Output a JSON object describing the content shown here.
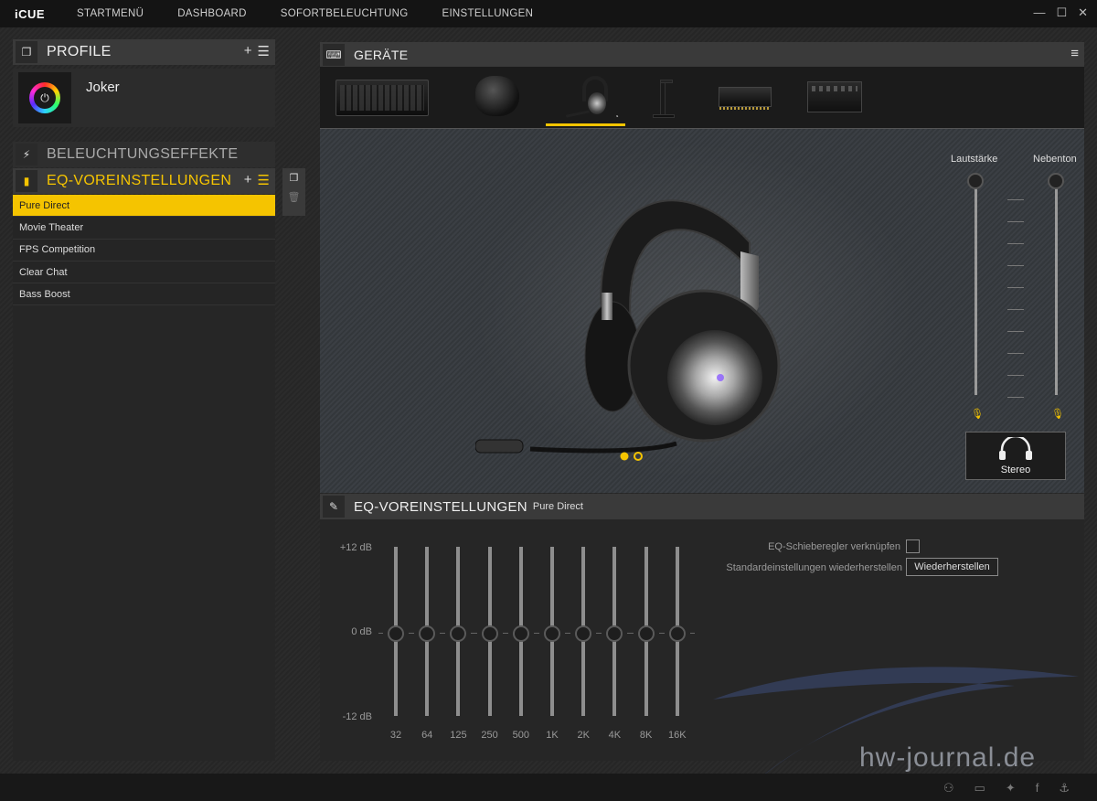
{
  "app": {
    "logo": "iCUE",
    "nav": [
      "STARTMENÜ",
      "DASHBOARD",
      "SOFORTBELEUCHTUNG",
      "EINSTELLUNGEN"
    ]
  },
  "window": {
    "minimize": "—",
    "maximize": "☐",
    "close": "✕"
  },
  "profile": {
    "title": "PROFILE",
    "add": "+",
    "menu": "☰",
    "name": "Joker"
  },
  "lighting": {
    "title": "BELEUCHTUNGSEFFEKTE"
  },
  "eq_presets": {
    "title": "EQ-VOREINSTELLUNGEN",
    "add": "+",
    "menu": "☰",
    "items": [
      "Pure Direct",
      "Movie Theater",
      "FPS Competition",
      "Clear Chat",
      "Bass Boost"
    ],
    "selected": "Pure Direct"
  },
  "devices": {
    "title": "GERÄTE",
    "menu": "≡",
    "selected_index": 2
  },
  "audio": {
    "volume_label": "Lautstärke",
    "sidetone_label": "Nebenton",
    "volume_level": 1.0,
    "sidetone_level": 1.0,
    "stereo_label": "Stereo"
  },
  "eq_panel": {
    "title": "EQ-VOREINSTELLUNGEN",
    "preset": "Pure Direct",
    "db_top": "+12 dB",
    "db_mid": "0 dB",
    "db_bottom": "-12 dB",
    "bands": [
      "32",
      "64",
      "125",
      "250",
      "500",
      "1K",
      "2K",
      "4K",
      "8K",
      "16K"
    ],
    "band_values_db": [
      0,
      0,
      0,
      0,
      0,
      0,
      0,
      0,
      0,
      0
    ],
    "link_label": "EQ-Schieberegler verknüpfen",
    "link_checked": false,
    "restore_label": "Standardeinstellungen wiederherstellen",
    "restore_button": "Wiederherstellen"
  },
  "watermark": "hw-journal.de",
  "colors": {
    "accent": "#f5c400",
    "panel": "#3a3a3a",
    "background": "#1e1e1e"
  }
}
